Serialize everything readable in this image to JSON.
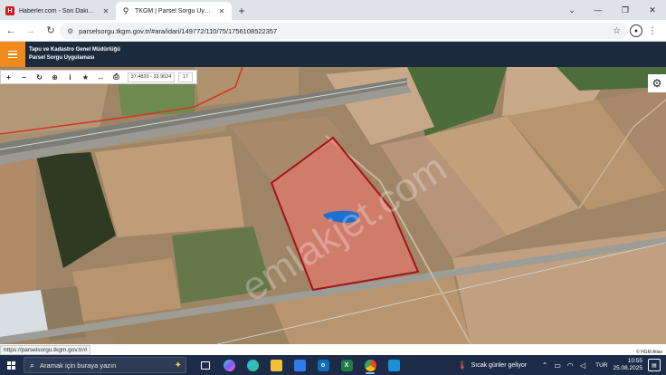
{
  "browser": {
    "tabs": [
      {
        "title": "Haberler.com - Son Dakika Haberler",
        "favicon": "H",
        "active": false
      },
      {
        "title": "TKGM | Parsel Sorgu Uygulaması",
        "favicon": "map-pin",
        "active": true
      }
    ],
    "new_tab_label": "+",
    "url": "parselsorgu.tkgm.gov.tr/#ara/idari/149772/110/75/1756108522357",
    "hover_url": "https://parselsorgu.tkgm.gov.tr/#"
  },
  "app": {
    "org_line1": "Tapu ve Kadastro Genel Müdürlüğü",
    "org_line2": "Parsel Sorgu Uygulaması",
    "accent": "#f08a1c",
    "header_color": "#1b2a3c"
  },
  "map_toolbar": {
    "tools": [
      "zoom-in",
      "zoom-out",
      "refresh",
      "locate",
      "info",
      "favorite",
      "measure",
      "print"
    ],
    "coordinates": "37.4820 - 33.9024",
    "zoom": "17"
  },
  "map": {
    "watermark": "emlakjet.com",
    "attribution": "© HGM Atlas",
    "parcel_color": "#e85a4f",
    "water_color": "#1f6fd1"
  },
  "taskbar": {
    "search_placeholder": "Aramak için buraya yazın",
    "weather_text": "Sıcak günler geliyor",
    "language": "TUR",
    "time": "10:55",
    "date": "25.08.2025",
    "apps": [
      "task-view",
      "copilot",
      "edge",
      "explorer",
      "store",
      "mail",
      "excel",
      "chrome",
      "photos"
    ]
  }
}
